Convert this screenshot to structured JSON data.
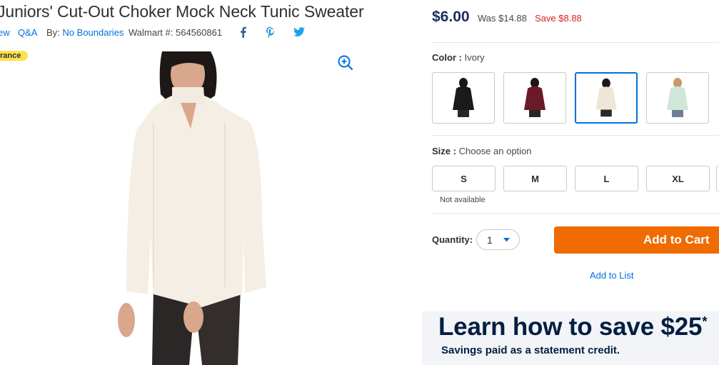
{
  "product": {
    "title": "Juniors' Cut-Out Choker Mock Neck Tunic Sweater",
    "review_link": "ew",
    "qa_link": "Q&A",
    "by_label": "By:",
    "brand": "No Boundaries",
    "walmart_label": "Walmart #:",
    "walmart_number": "564560861",
    "badge": "rance"
  },
  "pricing": {
    "price": "$6.00",
    "was": "Was $14.88",
    "save": "Save $8.88"
  },
  "color": {
    "label": "Color :",
    "selected": "Ivory",
    "swatches": [
      "Black",
      "Burgundy",
      "Ivory",
      "Mint"
    ]
  },
  "size": {
    "label": "Size :",
    "prompt": "Choose an option",
    "options": [
      "S",
      "M",
      "L",
      "XL"
    ],
    "unavailable_note": "Not available"
  },
  "purchase": {
    "quantity_label": "Quantity:",
    "quantity_value": "1",
    "add_to_cart": "Add to Cart",
    "add_to_list": "Add to List"
  },
  "promo": {
    "headline": "Learn how to save $25",
    "asterisk": "*",
    "subline": "Savings paid as a statement credit."
  },
  "colors": {
    "link": "#0071dc",
    "save_red": "#de1c24",
    "cart_orange": "#f06b00",
    "promo_navy": "#041e42"
  },
  "icons": [
    "facebook-icon",
    "pinterest-icon",
    "twitter-icon",
    "zoom-in-icon",
    "chevron-down-icon"
  ]
}
